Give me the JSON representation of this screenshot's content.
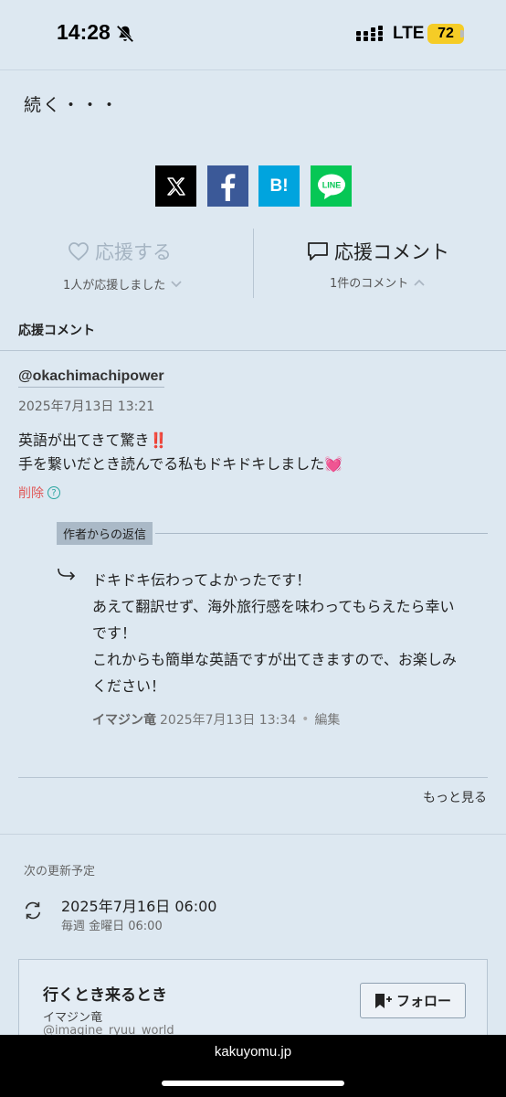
{
  "status_bar": {
    "time": "14:28",
    "network": "LTE",
    "battery": "72"
  },
  "story": {
    "continues": "続く・・・"
  },
  "share": {
    "hatena_label": "B!",
    "line_label": "LINE"
  },
  "cheer": {
    "button_label": "応援する",
    "count_text": "1人が応援しました"
  },
  "comments_toggle": {
    "button_label": "応援コメント",
    "count_text": "1件のコメント"
  },
  "comments_section": {
    "title": "応援コメント",
    "comment": {
      "user": "@okachimachipower",
      "date": "2025年7月13日 13:21",
      "line1": "英語が出てきて驚き‼️",
      "line2": "手を繋いだとき読んでる私もドキドキしました💓",
      "delete_label": "削除",
      "help_symbol": "?"
    },
    "reply": {
      "label": "作者からの返信",
      "line1": "ドキドキ伝わってよかったです！",
      "line2": "あえて翻訳せず、海外旅行感を味わってもらえたら幸い",
      "line3": "です！",
      "line4": "これからも簡単な英語ですが出てきますので、お楽しみ",
      "line5": "ください！",
      "author": "イマジン竜",
      "date": "2025年7月13日 13:34",
      "edit_label": "編集"
    },
    "more_label": "もっと見る"
  },
  "next_update": {
    "label": "次の更新予定",
    "date": "2025年7月16日 06:00",
    "schedule": "毎週 金曜日 06:00"
  },
  "work": {
    "title": "行くとき来るとき",
    "author": "イマジン竜",
    "handle": "@imagine_ryuu_world",
    "follow_label": "フォロー"
  },
  "browser": {
    "url": "kakuyomu.jp"
  },
  "colors": {
    "background": "#dde8f1",
    "facebook": "#3b5998",
    "hatena": "#00a4de",
    "line": "#06c755",
    "delete": "#e05a5a",
    "battery": "#f5cc26"
  }
}
